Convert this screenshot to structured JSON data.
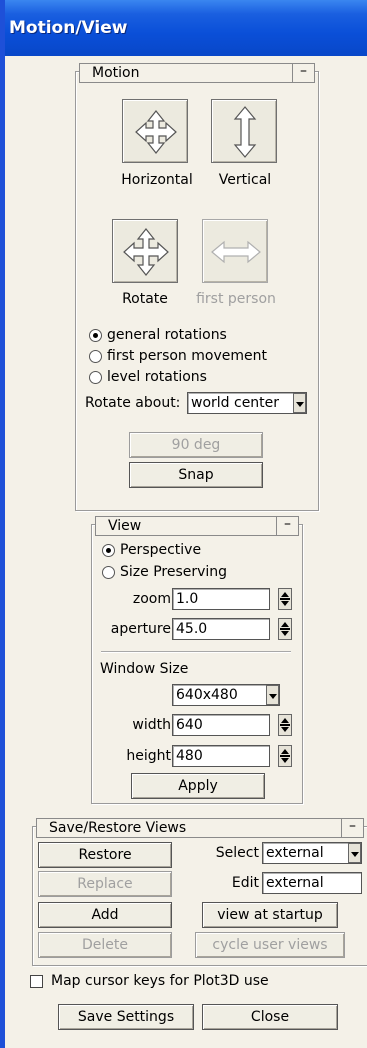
{
  "window": {
    "title": "Motion/View"
  },
  "motion": {
    "title": "Motion",
    "minimize": "–",
    "buttons": {
      "horizontal": "Horizontal",
      "vertical": "Vertical",
      "rotate": "Rotate",
      "first_person": "first person"
    },
    "radios": [
      {
        "label": "general rotations",
        "checked": true
      },
      {
        "label": "first person movement",
        "checked": false
      },
      {
        "label": "level rotations",
        "checked": false
      }
    ],
    "rotate_about_label": "Rotate about:",
    "rotate_about_value": "world center",
    "deg_button": "90 deg",
    "snap_button": "Snap"
  },
  "view": {
    "title": "View",
    "minimize": "–",
    "radios": [
      {
        "label": "Perspective",
        "checked": true
      },
      {
        "label": "Size Preserving",
        "checked": false
      }
    ],
    "zoom_label": "zoom",
    "zoom_value": "1.0",
    "aperture_label": "aperture",
    "aperture_value": "45.0",
    "window_size_label": "Window Size",
    "size_preset": "640x480",
    "width_label": "width",
    "width_value": "640",
    "height_label": "height",
    "height_value": "480",
    "apply_button": "Apply"
  },
  "saverestore": {
    "title": "Save/Restore Views",
    "minimize": "–",
    "restore": "Restore",
    "replace": "Replace",
    "add": "Add",
    "delete": "Delete",
    "select_label": "Select",
    "select_value": "external",
    "edit_label": "Edit",
    "edit_value": "external",
    "view_at_startup": "view at startup",
    "cycle_user_views": "cycle user views"
  },
  "footer": {
    "map_cursor_label": "Map cursor keys for Plot3D use",
    "save_settings": "Save Settings",
    "close": "Close"
  },
  "colors": {
    "titlebar": "#0a4fd8",
    "panel": "#f4f1e8",
    "border_left": "#1e50d8"
  }
}
